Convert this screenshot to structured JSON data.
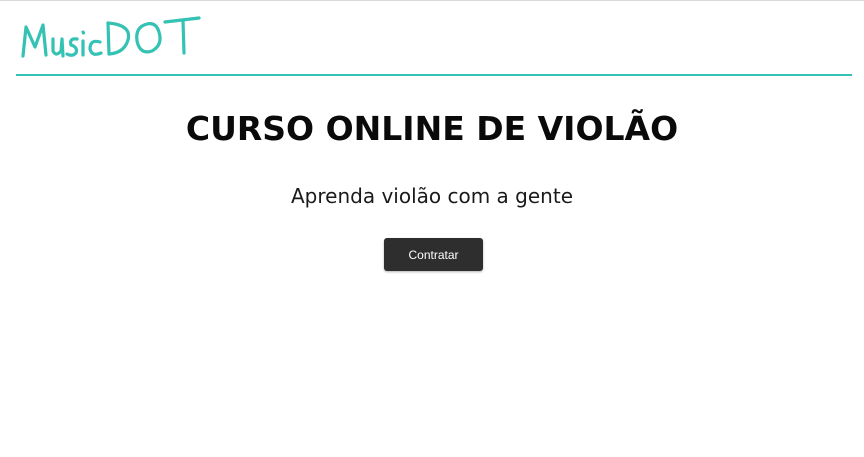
{
  "header": {
    "logo_text": "MusicDOT"
  },
  "hero": {
    "title": "CURSO ONLINE DE VIOLÃO",
    "subtitle": "Aprenda violão com a gente",
    "cta_label": "Contratar"
  },
  "colors": {
    "accent": "#33c2b3",
    "button_bg": "#2e2e2e",
    "title_text": "#0a0a0a"
  }
}
